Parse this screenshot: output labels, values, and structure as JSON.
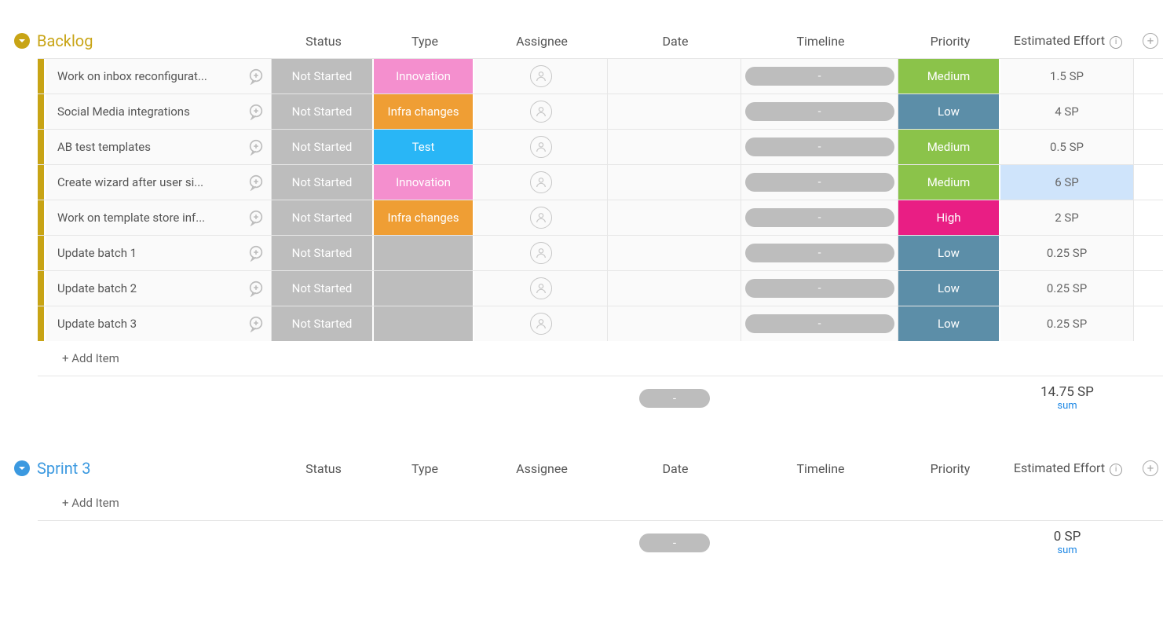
{
  "columns": [
    "Status",
    "Type",
    "Assignee",
    "Date",
    "Timeline",
    "Priority",
    "Estimated Effort"
  ],
  "add_item_label": "+ Add Item",
  "sum_label": "sum",
  "timeline_placeholder": "-",
  "summary_date_placeholder": "-",
  "groups": [
    {
      "id": "backlog",
      "title": "Backlog",
      "color_class": "backlog",
      "effort_sum": "14.75 SP",
      "items": [
        {
          "title": "Work on inbox reconfigurat...",
          "status": "Not Started",
          "type": "Innovation",
          "type_class": "type-innovation",
          "priority": "Medium",
          "priority_class": "prio-medium",
          "effort": "1.5 SP",
          "effort_hl": false
        },
        {
          "title": "Social Media integrations",
          "status": "Not Started",
          "type": "Infra changes",
          "type_class": "type-infra",
          "priority": "Low",
          "priority_class": "prio-low",
          "effort": "4 SP",
          "effort_hl": false
        },
        {
          "title": "AB test templates",
          "status": "Not Started",
          "type": "Test",
          "type_class": "type-test",
          "priority": "Medium",
          "priority_class": "prio-medium",
          "effort": "0.5 SP",
          "effort_hl": false
        },
        {
          "title": "Create wizard after user si...",
          "status": "Not Started",
          "type": "Innovation",
          "type_class": "type-innovation",
          "priority": "Medium",
          "priority_class": "prio-medium",
          "effort": "6 SP",
          "effort_hl": true
        },
        {
          "title": "Work on template store inf...",
          "status": "Not Started",
          "type": "Infra changes",
          "type_class": "type-infra",
          "priority": "High",
          "priority_class": "prio-high",
          "effort": "2 SP",
          "effort_hl": false
        },
        {
          "title": "Update batch 1",
          "status": "Not Started",
          "type": "",
          "type_class": "type-empty",
          "priority": "Low",
          "priority_class": "prio-low",
          "effort": "0.25 SP",
          "effort_hl": false
        },
        {
          "title": "Update batch 2",
          "status": "Not Started",
          "type": "",
          "type_class": "type-empty",
          "priority": "Low",
          "priority_class": "prio-low",
          "effort": "0.25 SP",
          "effort_hl": false
        },
        {
          "title": "Update batch 3",
          "status": "Not Started",
          "type": "",
          "type_class": "type-empty",
          "priority": "Low",
          "priority_class": "prio-low",
          "effort": "0.25 SP",
          "effort_hl": false
        }
      ]
    },
    {
      "id": "sprint3",
      "title": "Sprint 3",
      "color_class": "sprint",
      "effort_sum": "0 SP",
      "items": []
    }
  ]
}
